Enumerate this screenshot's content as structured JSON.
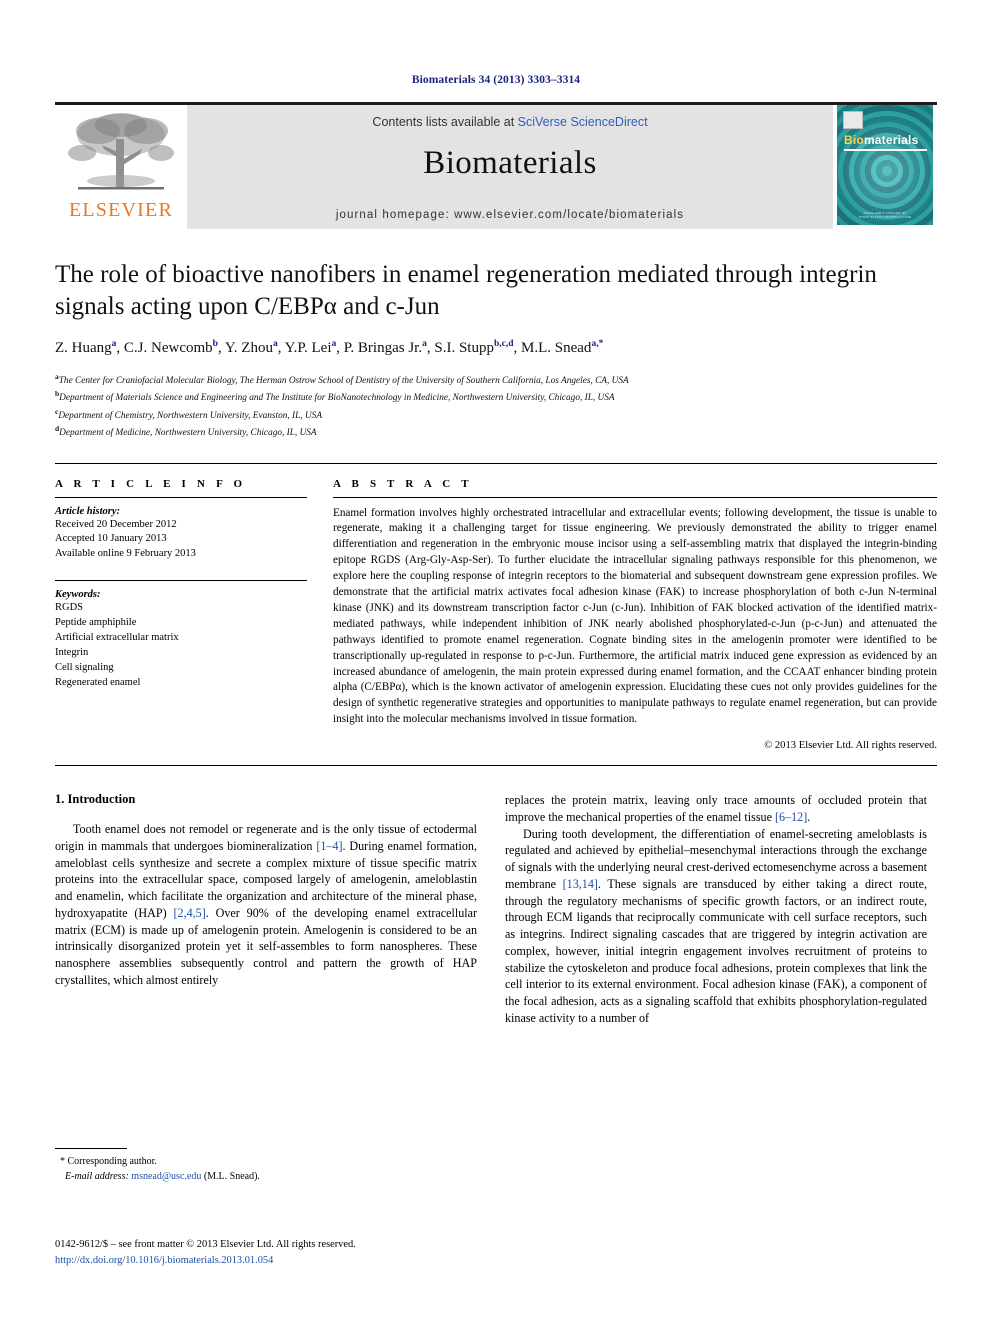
{
  "running_head": "Biomaterials 34 (2013) 3303–3314",
  "banner": {
    "publisher_name": "ELSEVIER",
    "publisher_logo_icon": "elsevier-tree-icon",
    "contents_prefix": "Contents lists available at ",
    "contents_link": "SciVerse ScienceDirect",
    "journal_title": "Biomaterials",
    "homepage": "journal homepage: www.elsevier.com/locate/biomaterials",
    "cover": {
      "title_bio": "Bio",
      "title_rest": "materials",
      "footer_text": "AVAILABLE ONLINE AT WWW.SCIENCEDIRECT.COM",
      "background_color": "#2aa8a8",
      "accent_color": "#ffd24a"
    }
  },
  "article": {
    "title": "The role of bioactive nanofibers in enamel regeneration mediated through integrin signals acting upon C/EBPα and c-Jun",
    "authors": [
      {
        "name": "Z. Huang",
        "sup": "a"
      },
      {
        "name": "C.J. Newcomb",
        "sup": "b"
      },
      {
        "name": "Y. Zhou",
        "sup": "a"
      },
      {
        "name": "Y.P. Lei",
        "sup": "a"
      },
      {
        "name": "P. Bringas Jr.",
        "sup": "a"
      },
      {
        "name": "S.I. Stupp",
        "sup": "b,c,d"
      },
      {
        "name": "M.L. Snead",
        "sup": "a,*"
      }
    ],
    "affiliations": [
      {
        "label": "a",
        "text": "The Center for Craniofacial Molecular Biology, The Herman Ostrow School of Dentistry of the University of Southern California, Los Angeles, CA, USA"
      },
      {
        "label": "b",
        "text": "Department of Materials Science and Engineering and The Institute for BioNanotechnology in Medicine, Northwestern University, Chicago, IL, USA"
      },
      {
        "label": "c",
        "text": "Department of Chemistry, Northwestern University, Evanston, IL, USA"
      },
      {
        "label": "d",
        "text": "Department of Medicine, Northwestern University, Chicago, IL, USA"
      }
    ]
  },
  "article_info": {
    "heading": "A R T I C L E   I N F O",
    "history_label": "Article history:",
    "history": [
      "Received 20 December 2012",
      "Accepted 10 January 2013",
      "Available online 9 February 2013"
    ],
    "keywords_label": "Keywords:",
    "keywords": [
      "RGDS",
      "Peptide amphiphile",
      "Artificial extracellular matrix",
      "Integrin",
      "Cell signaling",
      "Regenerated enamel"
    ]
  },
  "abstract": {
    "heading": "A B S T R A C T",
    "text": "Enamel formation involves highly orchestrated intracellular and extracellular events; following development, the tissue is unable to regenerate, making it a challenging target for tissue engineering. We previously demonstrated the ability to trigger enamel differentiation and regeneration in the embryonic mouse incisor using a self-assembling matrix that displayed the integrin-binding epitope RGDS (Arg-Gly-Asp-Ser). To further elucidate the intracellular signaling pathways responsible for this phenomenon, we explore here the coupling response of integrin receptors to the biomaterial and subsequent downstream gene expression profiles. We demonstrate that the artificial matrix activates focal adhesion kinase (FAK) to increase phosphorylation of both c-Jun N-terminal kinase (JNK) and its downstream transcription factor c-Jun (c-Jun). Inhibition of FAK blocked activation of the identified matrix-mediated pathways, while independent inhibition of JNK nearly abolished phosphorylated-c-Jun (p-c-Jun) and attenuated the pathways identified to promote enamel regeneration. Cognate binding sites in the amelogenin promoter were identified to be transcriptionally up-regulated in response to p-c-Jun. Furthermore, the artificial matrix induced gene expression as evidenced by an increased abundance of amelogenin, the main protein expressed during enamel formation, and the CCAAT enhancer binding protein alpha (C/EBPα), which is the known activator of amelogenin expression. Elucidating these cues not only provides guidelines for the design of synthetic regenerative strategies and opportunities to manipulate pathways to regulate enamel regeneration, but can provide insight into the molecular mechanisms involved in tissue formation.",
    "copyright": "© 2013 Elsevier Ltd. All rights reserved."
  },
  "body": {
    "section_number_title": "1.  Introduction",
    "left_paragraph_1_a": "Tooth enamel does not remodel or regenerate and is the only tissue of ectodermal origin in mammals that undergoes biomineralization ",
    "left_ref_1": "[1–4]",
    "left_paragraph_1_b": ". During enamel formation, ameloblast cells synthesize and secrete a complex mixture of tissue specific matrix proteins into the extracellular space, composed largely of amelogenin, ameloblastin and enamelin, which facilitate the organization and architecture of the mineral phase, hydroxyapatite (HAP) ",
    "left_ref_2": "[2,4,5]",
    "left_paragraph_1_c": ". Over 90% of the developing enamel extracellular matrix (ECM) is made up of amelogenin protein. Amelogenin is considered to be an intrinsically disorganized protein yet it self-assembles to form nanospheres. These nanosphere assemblies subsequently control and pattern the growth of HAP crystallites, which almost entirely",
    "right_paragraph_1_a": "replaces the protein matrix, leaving only trace amounts of occluded protein that improve the mechanical properties of the enamel tissue ",
    "right_ref_1": "[6–12]",
    "right_paragraph_1_b": ".",
    "right_paragraph_2_a": "During tooth development, the differentiation of enamel-secreting ameloblasts is regulated and achieved by epithelial–mesenchymal interactions through the exchange of signals with the underlying neural crest-derived ectomesenchyme across a basement membrane ",
    "right_ref_2": "[13,14]",
    "right_paragraph_2_b": ". These signals are transduced by either taking a direct route, through the regulatory mechanisms of specific growth factors, or an indirect route, through ECM ligands that reciprocally communicate with cell surface receptors, such as integrins. Indirect signaling cascades that are triggered by integrin activation are complex, however, initial integrin engagement involves recruitment of proteins to stabilize the cytoskeleton and produce focal adhesions, protein complexes that link the cell interior to its external environment. Focal adhesion kinase (FAK), a component of the focal adhesion, acts as a signaling scaffold that exhibits phosphorylation-regulated kinase activity to a number of"
  },
  "footnote": {
    "corresponding_marker": "*",
    "corresponding_label": "Corresponding author.",
    "email_label": "E-mail address:",
    "email": "msnead@usc.edu",
    "email_owner": "(M.L. Snead)."
  },
  "footer": {
    "issn_line": "0142-9612/$ – see front matter © 2013 Elsevier Ltd. All rights reserved.",
    "doi_line": "http://dx.doi.org/10.1016/j.biomaterials.2013.01.054"
  }
}
